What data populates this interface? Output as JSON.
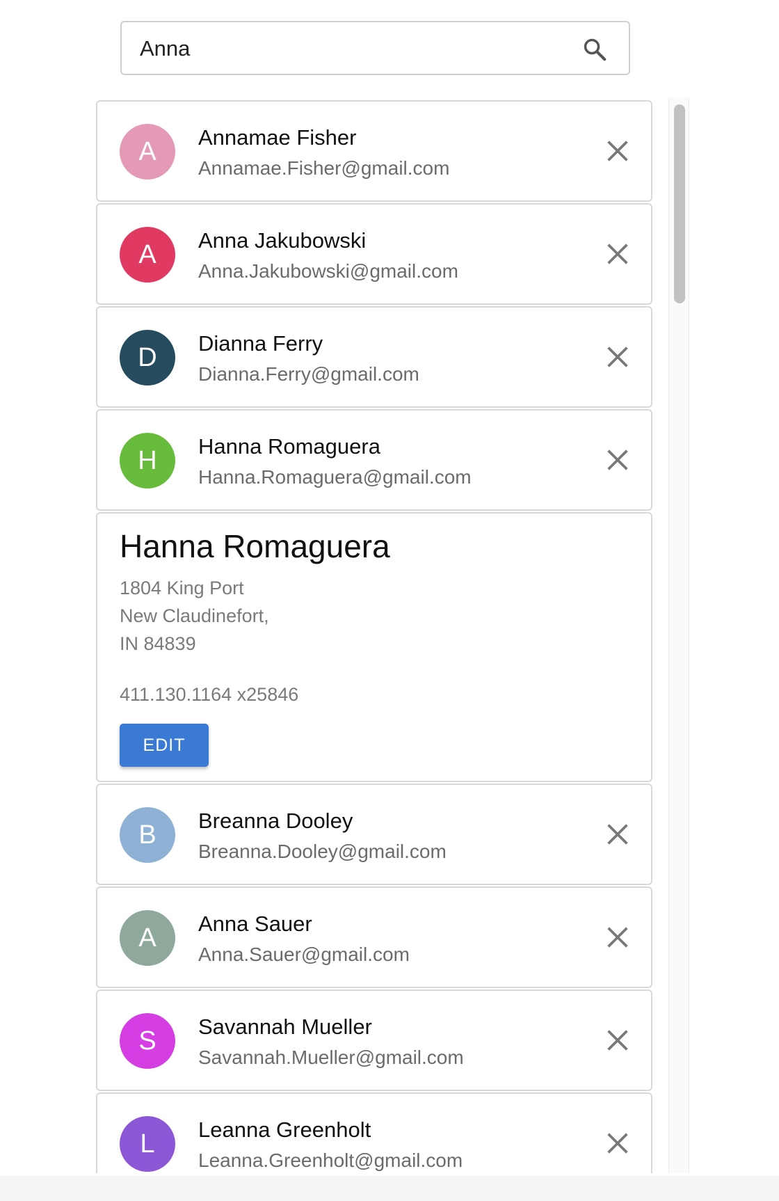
{
  "search": {
    "value": "Anna",
    "icon": "search-icon"
  },
  "contacts": [
    {
      "initial": "A",
      "name": "Annamae Fisher",
      "email": "Annamae.Fisher@gmail.com",
      "color": "#e49ab6"
    },
    {
      "initial": "A",
      "name": "Anna Jakubowski",
      "email": "Anna.Jakubowski@gmail.com",
      "color": "#e13a62"
    },
    {
      "initial": "D",
      "name": "Dianna Ferry",
      "email": "Dianna.Ferry@gmail.com",
      "color": "#264a5e"
    },
    {
      "initial": "H",
      "name": "Hanna Romaguera",
      "email": "Hanna.Romaguera@gmail.com",
      "color": "#67bd3b"
    }
  ],
  "detail": {
    "name": "Hanna Romaguera",
    "address_line1": "1804 King Port",
    "address_line2": "New Claudinefort,",
    "address_line3": "IN 84839",
    "phone": "411.130.1164 x25846",
    "edit_label": "EDIT",
    "edit_color": "#3a7ad5"
  },
  "contacts_after": [
    {
      "initial": "B",
      "name": "Breanna Dooley",
      "email": "Breanna.Dooley@gmail.com",
      "color": "#8eb1d5"
    },
    {
      "initial": "A",
      "name": "Anna Sauer",
      "email": "Anna.Sauer@gmail.com",
      "color": "#8ea99c"
    },
    {
      "initial": "S",
      "name": "Savannah Mueller",
      "email": "Savannah.Mueller@gmail.com",
      "color": "#d43ee2"
    },
    {
      "initial": "L",
      "name": "Leanna Greenholt",
      "email": "Leanna.Greenholt@gmail.com",
      "color": "#8c57d6"
    }
  ],
  "remove_icon": "close-icon"
}
